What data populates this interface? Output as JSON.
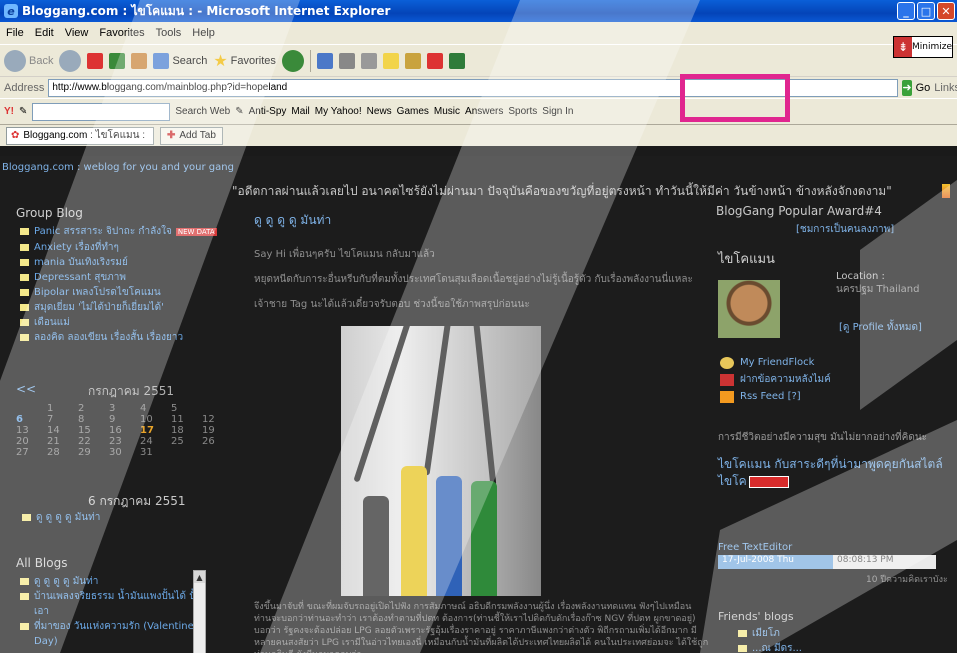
{
  "window": {
    "title": "Bloggang.com : ไขโคแมน : - Microsoft Internet Explorer",
    "min": "_",
    "max": "□",
    "close": "✕"
  },
  "menu": [
    "File",
    "Edit",
    "View",
    "Favorites",
    "Tools",
    "Help"
  ],
  "toolbar": {
    "back": "Back",
    "search": "Search",
    "favorites": "Favorites"
  },
  "address": {
    "label": "Address",
    "url": "http://www.bloggang.com/mainblog.php?id=hopeland",
    "go": "Go",
    "links": "Links"
  },
  "yahoo": {
    "search_web": "Search Web",
    "antispy": "Anti-Spy",
    "mail": "Mail",
    "my_yahoo": "My Yahoo!",
    "news": "News",
    "games": "Games",
    "music": "Music",
    "answers": "Answers",
    "sports": "Sports",
    "sign_in": "Sign In"
  },
  "tabs": {
    "active": "Bloggang.com : ไขโคแมน :",
    "add": "Add Tab"
  },
  "minimize_label": "Minimize",
  "site": {
    "link": "Bloggang.com : weblog for you and your gang",
    "quote": "\"อดีตกาลผ่านแล้วเลยไป อนาคตไซร้ยังไม่ผ่านมา ปัจจุบันคือของขวัญที่อยู่ตรงหน้า ทำวันนี้ให้มีค่า วันข้างหน้า ข้างหลังจักงดงาม\""
  },
  "group_blog": {
    "title": "Group Blog",
    "items": [
      "Panic สรรสาระ จิปาถะ กำลังใจ",
      "Anxiety เรื่องที่ทำๆ",
      "mania บันเทิงเริงรมย์",
      "Depressant สุขภาพ",
      "Bipolar เพลงโปรดไขโคแมน",
      "สมุดเยี่ยม 'ไม่ได้ป่ายก็เยี่ยมได้'",
      "เดือนแม่",
      "ลองคิด ลองเขียน เรื่องสั้น เรื่องยาว"
    ],
    "new_badge": "NEW DATA"
  },
  "calendar": {
    "prev": "<<",
    "month": "กรกฎาคม 2551",
    "rows": [
      [
        "",
        "1",
        "2",
        "3",
        "4",
        "5",
        ""
      ],
      [
        "6",
        "7",
        "8",
        "9",
        "10",
        "11",
        "12"
      ],
      [
        "13",
        "14",
        "15",
        "16",
        "17",
        "18",
        "19"
      ],
      [
        "20",
        "21",
        "22",
        "23",
        "24",
        "25",
        "26"
      ],
      [
        "27",
        "28",
        "29",
        "30",
        "31",
        "",
        ""
      ]
    ],
    "selected_date": "6 กรกฎาคม 2551",
    "entry": "ดู ดู ดู ดู มันท่า"
  },
  "all_blogs": {
    "title": "All Blogs",
    "items": [
      "ดู ดู ดู ดู มันท่า",
      "บ้านเพลงจริยธรรม น้ำมันแพงปั้นได้ ปั้นเอา",
      "ที่มาของ วันแห่งความรัก (Valentine 's Day)",
      "..."
    ]
  },
  "post": {
    "title": "ดู ดู ดู ดู มันท่า",
    "p1": "Say Hi เพื่อนๆครับ ไขโคแมน กลับมาแล้ว",
    "p2": "หยุดหนีดกับการะอื่นหรีบกับที่ตมทั้งประเทศโดนสุมเลือดเนื้อชยู่อย่างไม่รู้เนื้อรู้ตัว กับเรื่องพลังงานนี่แหละ",
    "p3": "เจ้าชาย Tag นะได้แล้วเดี๋ยวจรับตอบ ช่วงนี้ขอใช้ภาพสรุปก่อนนะ",
    "body": "จึงขึ้นมาจับที่ ขณะที่ผมจับรถอยู่เปิดไปฟัง การสัมภาษณ์ อธิบดีกรมพลังงานผู้นึ่ง เรื่องพลังงานทดแทน ฟังๆไปเหมือน ท่านจะบอกว่าท่านอะทำว่า เราต้องทำตามที่ปตท ต้องการ(ท่านชี้ให้เราไปติดกับดักเรื่องก๊าซ NGV ที่ปตท ผูกขาดอยู่) บอกว่า รัฐคงจะต้องปล่อย LPG ลอยตัวเพราะรัฐอุ้มเรื่องราคาอยู่ ราคาภาษีแพงกว่าต่างตัว พิถีกรถามเพิ่มได้อีกมาก มีหลายคนสงสัยว่า LPG เรามีในอ่าวไทยเองนี่ เหมือนกับน้ำมันที่ผลิตได้ประเทศไทยผลิตได้ คนในประเทศย่อมจะ ได้ใช้ถูก ท่านอธิบดี ยังมีนามาคอบว่า ....."
  },
  "right": {
    "award": "BlogGang Popular Award#4",
    "award_link": "[ชมการเป็นคนลงภาพ]",
    "handle": "ไขโคแมน",
    "location_label": "Location :",
    "location": "นครปฐม Thailand",
    "profile_link": "[ดู Profile ทั้งหมด]",
    "friendflock": "My FriendFlock",
    "leave_msg": "ฝากข้อความหลังไมค์",
    "rss": "Rss Feed [?]",
    "quote": "การมีชีวิตอย่างมีความสุข มันไม่ยากอย่างที่คิดนะ",
    "tagline": "ไขโคแมน กับสาระดีๆที่น่ามาพูดคุยกันสไตล์ไขโค",
    "editor": "Free TextEditor",
    "date": "17-Jul-2008  Thu",
    "time": "08:08:13 PM",
    "count": "10 ปีความคิดเราบังะ",
    "friends_title": "Friends' blogs",
    "friends": [
      "เมียโภ",
      "...ณ มีดร..."
    ]
  }
}
